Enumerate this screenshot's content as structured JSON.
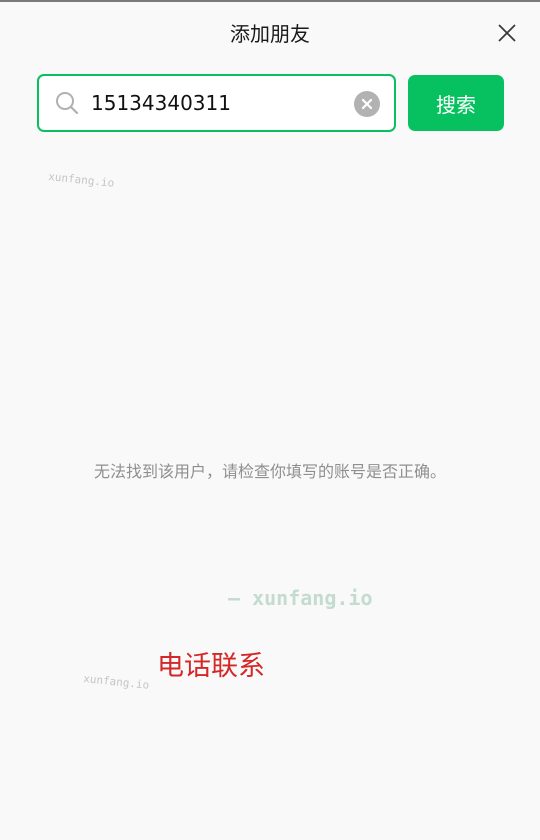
{
  "header": {
    "title": "添加朋友",
    "close_icon": "close-icon"
  },
  "search": {
    "value": "15134340311",
    "search_icon": "search-icon",
    "clear_icon": "clear-icon",
    "button_label": "搜索"
  },
  "result": {
    "message": "无法找到该用户，请检查你填写的账号是否正确。"
  },
  "overlay": {
    "watermark_small_1": "xunfang.io",
    "watermark_small_2": "xunfang.io",
    "watermark_large": "— xunfang.io",
    "phone_contact": "电话联系"
  },
  "colors": {
    "accent": "#07c160",
    "background": "#f9f9f9",
    "message_text": "#8f8f8f",
    "contact_red": "#d42828"
  }
}
